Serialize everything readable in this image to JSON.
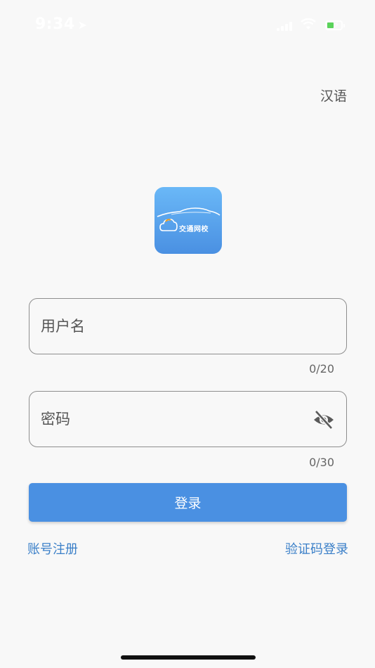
{
  "status_bar": {
    "time": "9:34",
    "location_icon": "location-arrow-icon",
    "signal_icon": "cellular-signal-icon",
    "wifi_icon": "wifi-icon",
    "battery_icon": "battery-charging-icon"
  },
  "language": {
    "label": "汉语"
  },
  "logo": {
    "text": "交通网校",
    "icon": "car-cloud-logo-icon"
  },
  "username": {
    "placeholder": "用户名",
    "value": "",
    "counter": "0/20"
  },
  "password": {
    "placeholder": "密码",
    "value": "",
    "counter": "0/30",
    "toggle_icon": "eye-slash-icon"
  },
  "login_button": {
    "label": "登录"
  },
  "links": {
    "register": "账号注册",
    "sms_login": "验证码登录"
  },
  "colors": {
    "primary": "#4a90e2",
    "link": "#3a7fc8",
    "background": "#f8f8f8",
    "battery": "#5bd35b"
  }
}
